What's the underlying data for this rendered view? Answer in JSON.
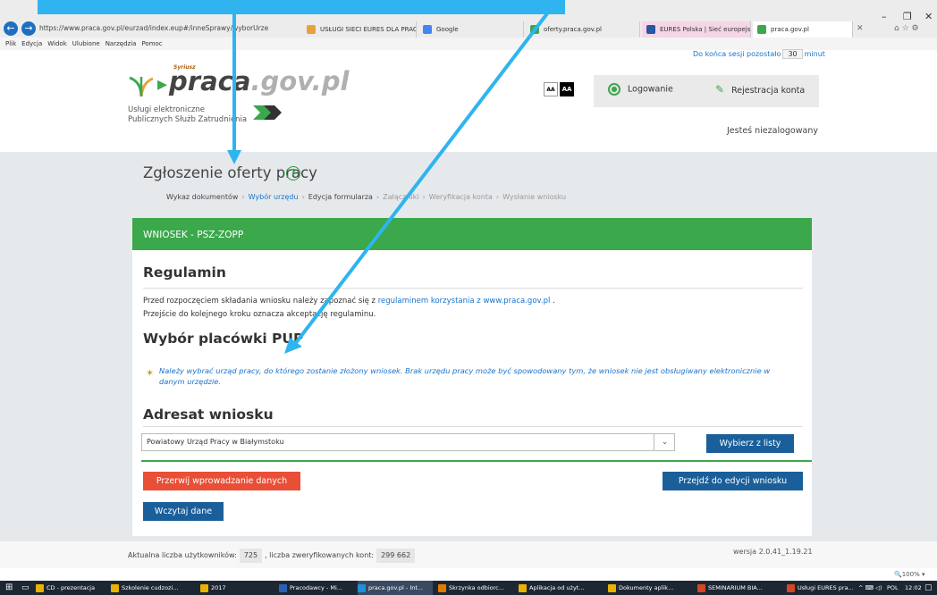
{
  "browser": {
    "url": "https://www.praca.gov.pl/eurzad/index.eup#/inneSprawy/wyborUrze",
    "tabs": [
      {
        "label": "USŁUGI SIECI EURES DLA PRAC...",
        "color": "#e9a23b"
      },
      {
        "label": "Google",
        "color": "#4285f4"
      },
      {
        "label": "oferty.praca.gov.pl",
        "color": "#3aa84b"
      },
      {
        "label": "EURES Polska | Sieć europejskic...",
        "color": "#2857a4"
      },
      {
        "label": "praca.gov.pl",
        "color": "#3aa84b"
      }
    ],
    "menu": [
      "Plik",
      "Edycja",
      "Widok",
      "Ulubione",
      "Narzędzia",
      "Pomoc"
    ]
  },
  "header": {
    "session_prefix": "Do końca sesji pozostało",
    "session_minutes": "30",
    "session_suffix": "minut",
    "logo_small": "Syriusz",
    "logo_main": "praca",
    "logo_tld": ".gov.pl",
    "eservices_line1": "Usługi elektroniczne",
    "eservices_line2": "Publicznych Służb Zatrudnienia",
    "font_small": "AA",
    "font_large": "AA",
    "login": "Logowanie",
    "register": "Rejestracja konta",
    "not_logged": "Jesteś niezalogowany"
  },
  "page": {
    "title": "Zgłoszenie oferty pracy",
    "breadcrumb": [
      {
        "label": "Wykaz dokumentów",
        "state": "done"
      },
      {
        "label": "Wybór urzędu",
        "state": "active"
      },
      {
        "label": "Edycja formularza",
        "state": "done"
      },
      {
        "label": "Załączniki",
        "state": "pending"
      },
      {
        "label": "Weryfikacja konta",
        "state": "pending"
      },
      {
        "label": "Wysłanie wniosku",
        "state": "pending"
      }
    ],
    "card_title": "WNIOSEK - PSZ-ZOPP",
    "rules_heading": "Regulamin",
    "rules_text1": "Przed rozpoczęciem składania wniosku należy zapoznać się z",
    "rules_link": "regulaminem korzystania z www.praca.gov.pl",
    "rules_text1_end": ".",
    "rules_text2": "Przejście do kolejnego kroku oznacza akceptację regulaminu.",
    "office_heading": "Wybór placówki PUP",
    "info": "Należy wybrać urząd pracy, do którego zostanie złożony wniosek. Brak urzędu pracy może być spowodowany tym, że wniosek nie jest obsługiwany elektronicznie w danym urzędzie.",
    "addressee_heading": "Adresat wniosku",
    "selected_office": "Powiatowy Urząd Pracy w Białymstoku",
    "choose_from_list": "Wybierz z listy",
    "abort": "Przerwij wprowadzanie danych",
    "go_edit": "Przejdź do edycji wniosku",
    "load_data": "Wczytaj dane"
  },
  "footer": {
    "users_label": "Aktualna liczba użytkowników:",
    "users_count": "725",
    "verified_label": ", liczba zweryfikowanych kont:",
    "verified_count": "299 662",
    "version": "wersja 2.0.41_1.19.21",
    "zoom": "100%"
  },
  "taskbar": {
    "items": [
      {
        "label": "CD - prezentacja",
        "color": "#e9b200"
      },
      {
        "label": "Szkolenie cudzozi...",
        "color": "#e9b200"
      },
      {
        "label": "2017",
        "color": "#e9b200"
      },
      {
        "label": "Pracodawcy - Mi...",
        "color": "#2b5fb4"
      },
      {
        "label": "praca.gov.pl - Int...",
        "color": "#1e8fd8"
      },
      {
        "label": "Skrzynka odbiorc...",
        "color": "#e07b00"
      },
      {
        "label": "Aplikacja od użyt...",
        "color": "#e9b200"
      },
      {
        "label": "Dokumenty aplik...",
        "color": "#e9b200"
      },
      {
        "label": "SEMINARIUM BIA...",
        "color": "#d24726"
      },
      {
        "label": "Usługi EURES pra...",
        "color": "#d24726"
      }
    ],
    "lang": "POL",
    "time": "12:02"
  },
  "colors": {
    "accent_green": "#3aa84b",
    "link_blue": "#1a73c9",
    "primary_button": "#1a5f9a",
    "danger_button": "#e94f37",
    "overlay_arrow": "#2fb4f0"
  }
}
